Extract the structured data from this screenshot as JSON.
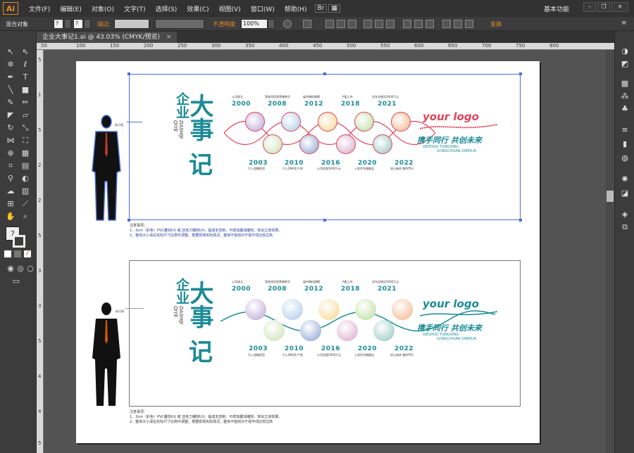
{
  "app": {
    "logo": "Ai",
    "workspace": "基本功能"
  },
  "menu": [
    "文件(F)",
    "编辑(E)",
    "对象(O)",
    "文字(T)",
    "选择(S)",
    "效果(C)",
    "视图(V)",
    "窗口(W)",
    "帮助(H)"
  ],
  "controlbar": {
    "selection": "混合对象",
    "stroke_label": "描边:",
    "opacity_label": "不透明度:",
    "opacity_value": "100%",
    "transform_label": "变换"
  },
  "document": {
    "tab_title": "企业大事记1.ai @ 43.03% (CMYK/预览)",
    "close": "×"
  },
  "ruler_h": [
    "50",
    "100",
    "150",
    "200",
    "250",
    "300",
    "350",
    "400",
    "450",
    "500",
    "550",
    "600",
    "650",
    "700",
    "750",
    "800"
  ],
  "ruler_v": [
    "5",
    "1",
    "5",
    "2",
    "2",
    "5",
    "3",
    "3",
    "5",
    "4",
    "4",
    "5"
  ],
  "design": {
    "title_small": "企业",
    "title_big_1": "大事",
    "title_big_2": "记",
    "pinyin_1": "QIYE",
    "pinyin_2": "DASHIJI",
    "logo": "your logo",
    "slogan": "携手同行 共创未来",
    "slogan_pinyin_1": "XIESHOU TONGXING",
    "slogan_pinyin_2": "GONGCHUAN GWEILAI",
    "height_label": "标尺线",
    "top_years": [
      {
        "year": "2000",
        "caption": "公司成立"
      },
      {
        "year": "2008",
        "caption": "获各项优质荣誉称号"
      },
      {
        "year": "2012",
        "caption": "省市物料规模"
      },
      {
        "year": "2018",
        "caption": "A股上市"
      },
      {
        "year": "2021",
        "caption": "全年业绩达5000万元"
      }
    ],
    "bottom_years": [
      {
        "year": "2003",
        "caption": "引入战略投资"
      },
      {
        "year": "2010",
        "caption": "引入DNA生产线"
      },
      {
        "year": "2016",
        "caption": "公司估值5000万元"
      },
      {
        "year": "2020",
        "caption": "入驻京东旗舰店"
      },
      {
        "year": "2022",
        "caption": "初心始终 使命笃行"
      }
    ],
    "notes_title": "注意事项：",
    "notes_1": "1、3cm（彩色）PVC雕刻UV 或 亚克力雕刻UV；提成本控制，可增加叠加雕刻，突出立体效果。",
    "notes_2": "2、整体大小请在实际尺寸比例中调整，根据现场实际情况，整体不能刻对于视平线比较过高"
  },
  "colors": {
    "accent": "#1b8a95",
    "selection": "#4d6fd6",
    "logo_red": "#e0445a",
    "circle_colors": [
      "#b9a3d4",
      "#c8e0b0",
      "#a7c8e6",
      "#f5d58a",
      "#d8a7c9",
      "#f2b184",
      "#c9e6ec",
      "#8aa0cf",
      "#b8dc9c",
      "#8fc4bd"
    ]
  },
  "icons": {
    "tools": [
      "selection-icon",
      "direct-selection-icon",
      "magic-wand-icon",
      "lasso-icon",
      "pen-icon",
      "type-icon",
      "line-icon",
      "rectangle-icon",
      "paintbrush-icon",
      "pencil-icon",
      "blob-brush-icon",
      "eraser-icon",
      "rotate-icon",
      "scale-icon",
      "width-icon",
      "free-transform-icon",
      "shape-builder-icon",
      "perspective-grid-icon",
      "mesh-icon",
      "gradient-icon",
      "eyedropper-icon",
      "blend-icon",
      "symbol-sprayer-icon",
      "column-graph-icon",
      "artboard-icon",
      "slice-icon",
      "hand-icon",
      "zoom-icon"
    ],
    "right": [
      "color-panel-icon",
      "color-guide-icon",
      "swatches-icon",
      "brushes-icon",
      "symbols-icon",
      "stroke-icon",
      "gradient-panel-icon",
      "transparency-icon",
      "appearance-icon",
      "graphic-styles-icon",
      "layers-icon",
      "artboards-icon"
    ]
  }
}
